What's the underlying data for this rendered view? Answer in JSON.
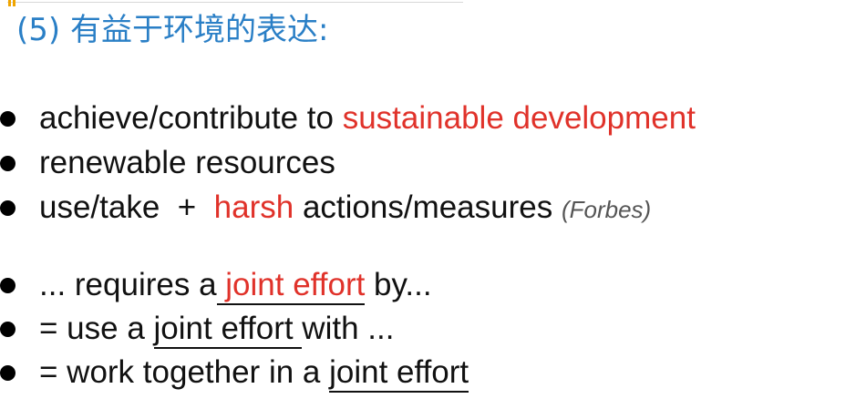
{
  "heading": "(5) 有益于环境的表达:",
  "bullets": {
    "b1": {
      "pre": "achieve/contribute to ",
      "highlight": "sustainable development"
    },
    "b2": {
      "text": "renewable resources"
    },
    "b3": {
      "pre": "use/take  +  ",
      "highlight": "harsh",
      "post": " actions/measures ",
      "source": "(Forbes)"
    },
    "b4": {
      "pre": "... requires a",
      "underlined": " joint effort",
      "post": " by..."
    },
    "b5": {
      "pre": "= use a ",
      "underlined": "joint effort ",
      "post": "with ..."
    },
    "b6": {
      "pre": "= work together in a ",
      "underlined": "joint effort"
    }
  },
  "colors": {
    "heading": "#2a7fc6",
    "highlight": "#e0322a",
    "text": "#111111",
    "source": "#555555"
  }
}
